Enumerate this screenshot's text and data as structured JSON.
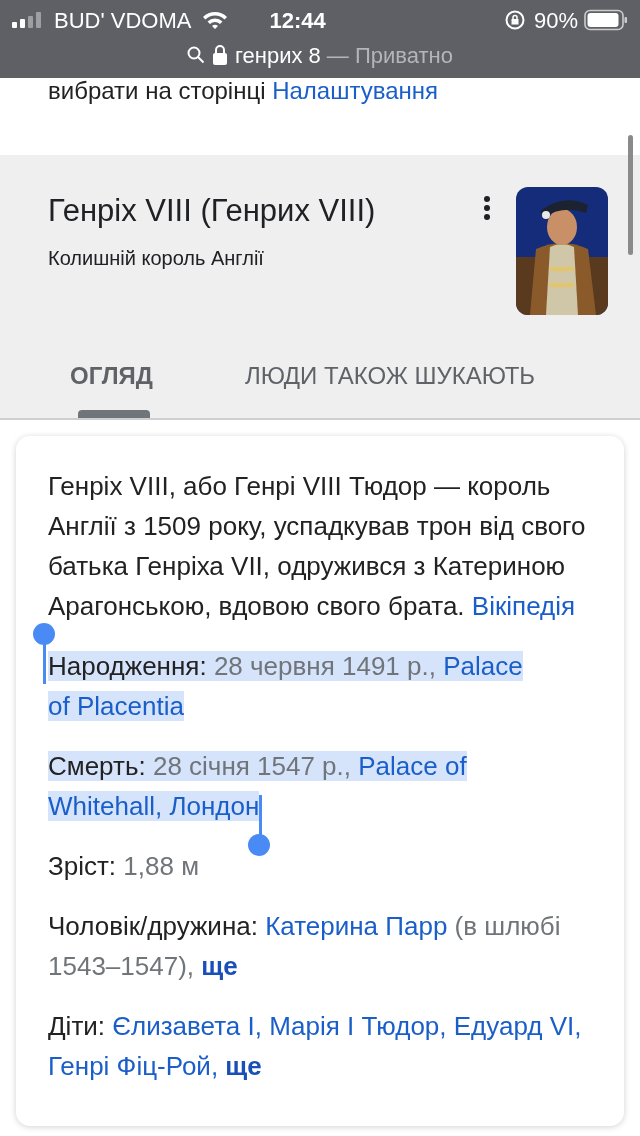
{
  "status_bar": {
    "carrier": "BUD' VDOMA",
    "time": "12:44",
    "battery": "90%"
  },
  "address_bar": {
    "query": "генрих 8",
    "mode": "— Приватно"
  },
  "top_text": {
    "text": "вибрати на сторінці",
    "link": "Налаштування"
  },
  "panel": {
    "title": "Генріх VIII (Генрих VIII)",
    "subtitle": "Колишній король Англії",
    "tabs": [
      {
        "label": "ОГЛЯД",
        "selected": true
      },
      {
        "label": "ЛЮДИ ТАКОЖ ШУКАЮТЬ",
        "selected": false
      }
    ]
  },
  "description": {
    "text": "Генріх VIII, або Генрі VIII Тюдор — король Англії з 1509 року, успадкував трон від свого батька Генріха VII, одружився з Катериною Арагонською, вдовою свого брата.",
    "source": "Вікіпедія"
  },
  "facts": [
    {
      "label": "Народження:",
      "selected": true,
      "parts": [
        {
          "kind": "value",
          "text": "28 червня 1491 р.,"
        },
        {
          "kind": "link",
          "text": "Palace"
        },
        {
          "kind": "link",
          "text": "of Placentia"
        }
      ]
    },
    {
      "label": "Смерть:",
      "selected": true,
      "parts": [
        {
          "kind": "value",
          "text": "28 січня 1547 р.,"
        },
        {
          "kind": "link",
          "text": "Palace of"
        },
        {
          "kind": "link",
          "text": "Whitehall, Лондон"
        }
      ]
    },
    {
      "label": "Зріст:",
      "selected": false,
      "parts": [
        {
          "kind": "value",
          "text": "1,88 м"
        }
      ]
    },
    {
      "label": "Чоловік/дружина:",
      "selected": false,
      "parts": [
        {
          "kind": "link",
          "text": "Катерина Парр"
        },
        {
          "kind": "value",
          "text": "(в шлюбі 1543–1547),"
        },
        {
          "kind": "more",
          "text": "ще"
        }
      ]
    },
    {
      "label": "Діти:",
      "selected": false,
      "parts": [
        {
          "kind": "link",
          "text": "Єлизавета I,"
        },
        {
          "kind": "link",
          "text": "Марія I Тюдор,"
        },
        {
          "kind": "link",
          "text": "Едуард"
        },
        {
          "kind": "link",
          "text": "VI,"
        },
        {
          "kind": "link",
          "text": "Генрі Фіц-Рой,"
        },
        {
          "kind": "more",
          "text": "ще"
        }
      ]
    }
  ]
}
